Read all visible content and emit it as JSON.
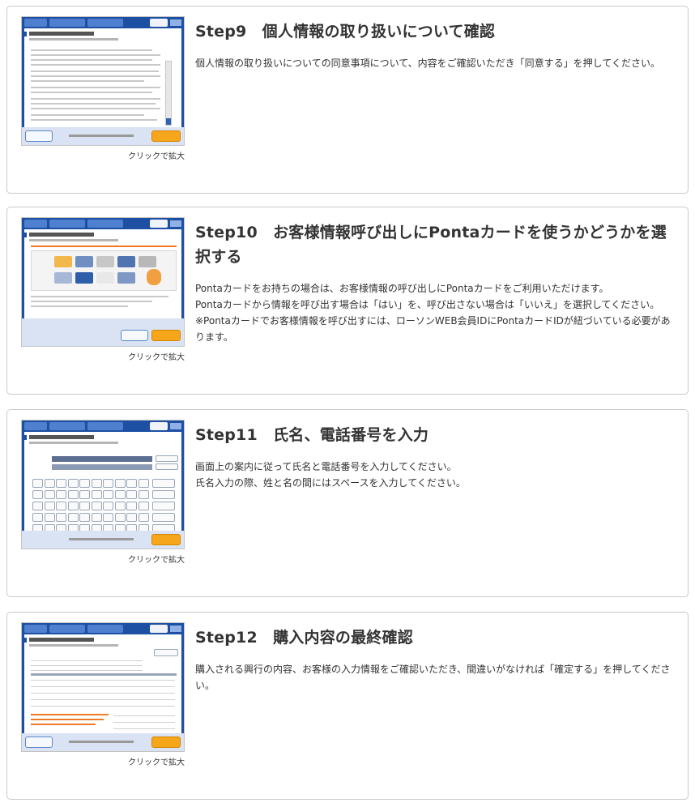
{
  "enlarge_label": "クリックで拡大",
  "accent_color": "#1d4fa3",
  "button_color": "#f6a61a",
  "steps": [
    {
      "title": "Step9　個人情報の取り扱いについて確認",
      "desc": [
        "個人情報の取り扱いについての同意事項について、内容をご確認いただき「同意する」を押してください。"
      ]
    },
    {
      "title": "Step10　お客様情報呼び出しにPontaカードを使うかどうかを選択する",
      "desc": [
        "Pontaカードをお持ちの場合は、お客様情報の呼び出しにPontaカードをご利用いただけます。",
        "Pontaカードから情報を呼び出す場合は「はい」を、呼び出さない場合は「いいえ」を選択してください。",
        "※Pontaカードでお客様情報を呼び出すには、ローソンWEB会員IDにPontaカードIDが紐づいている必要があります。"
      ]
    },
    {
      "title": "Step11　氏名、電話番号を入力",
      "desc": [
        "画面上の案内に従って氏名と電話番号を入力してください。",
        "氏名入力の際、姓と名の間にはスペースを入力してください。"
      ]
    },
    {
      "title": "Step12　購入内容の最終確認",
      "desc": [
        "購入される興行の内容、お客様の入力情報をご確認いただき、間違いがなければ「確定する」を押してください。"
      ]
    }
  ]
}
